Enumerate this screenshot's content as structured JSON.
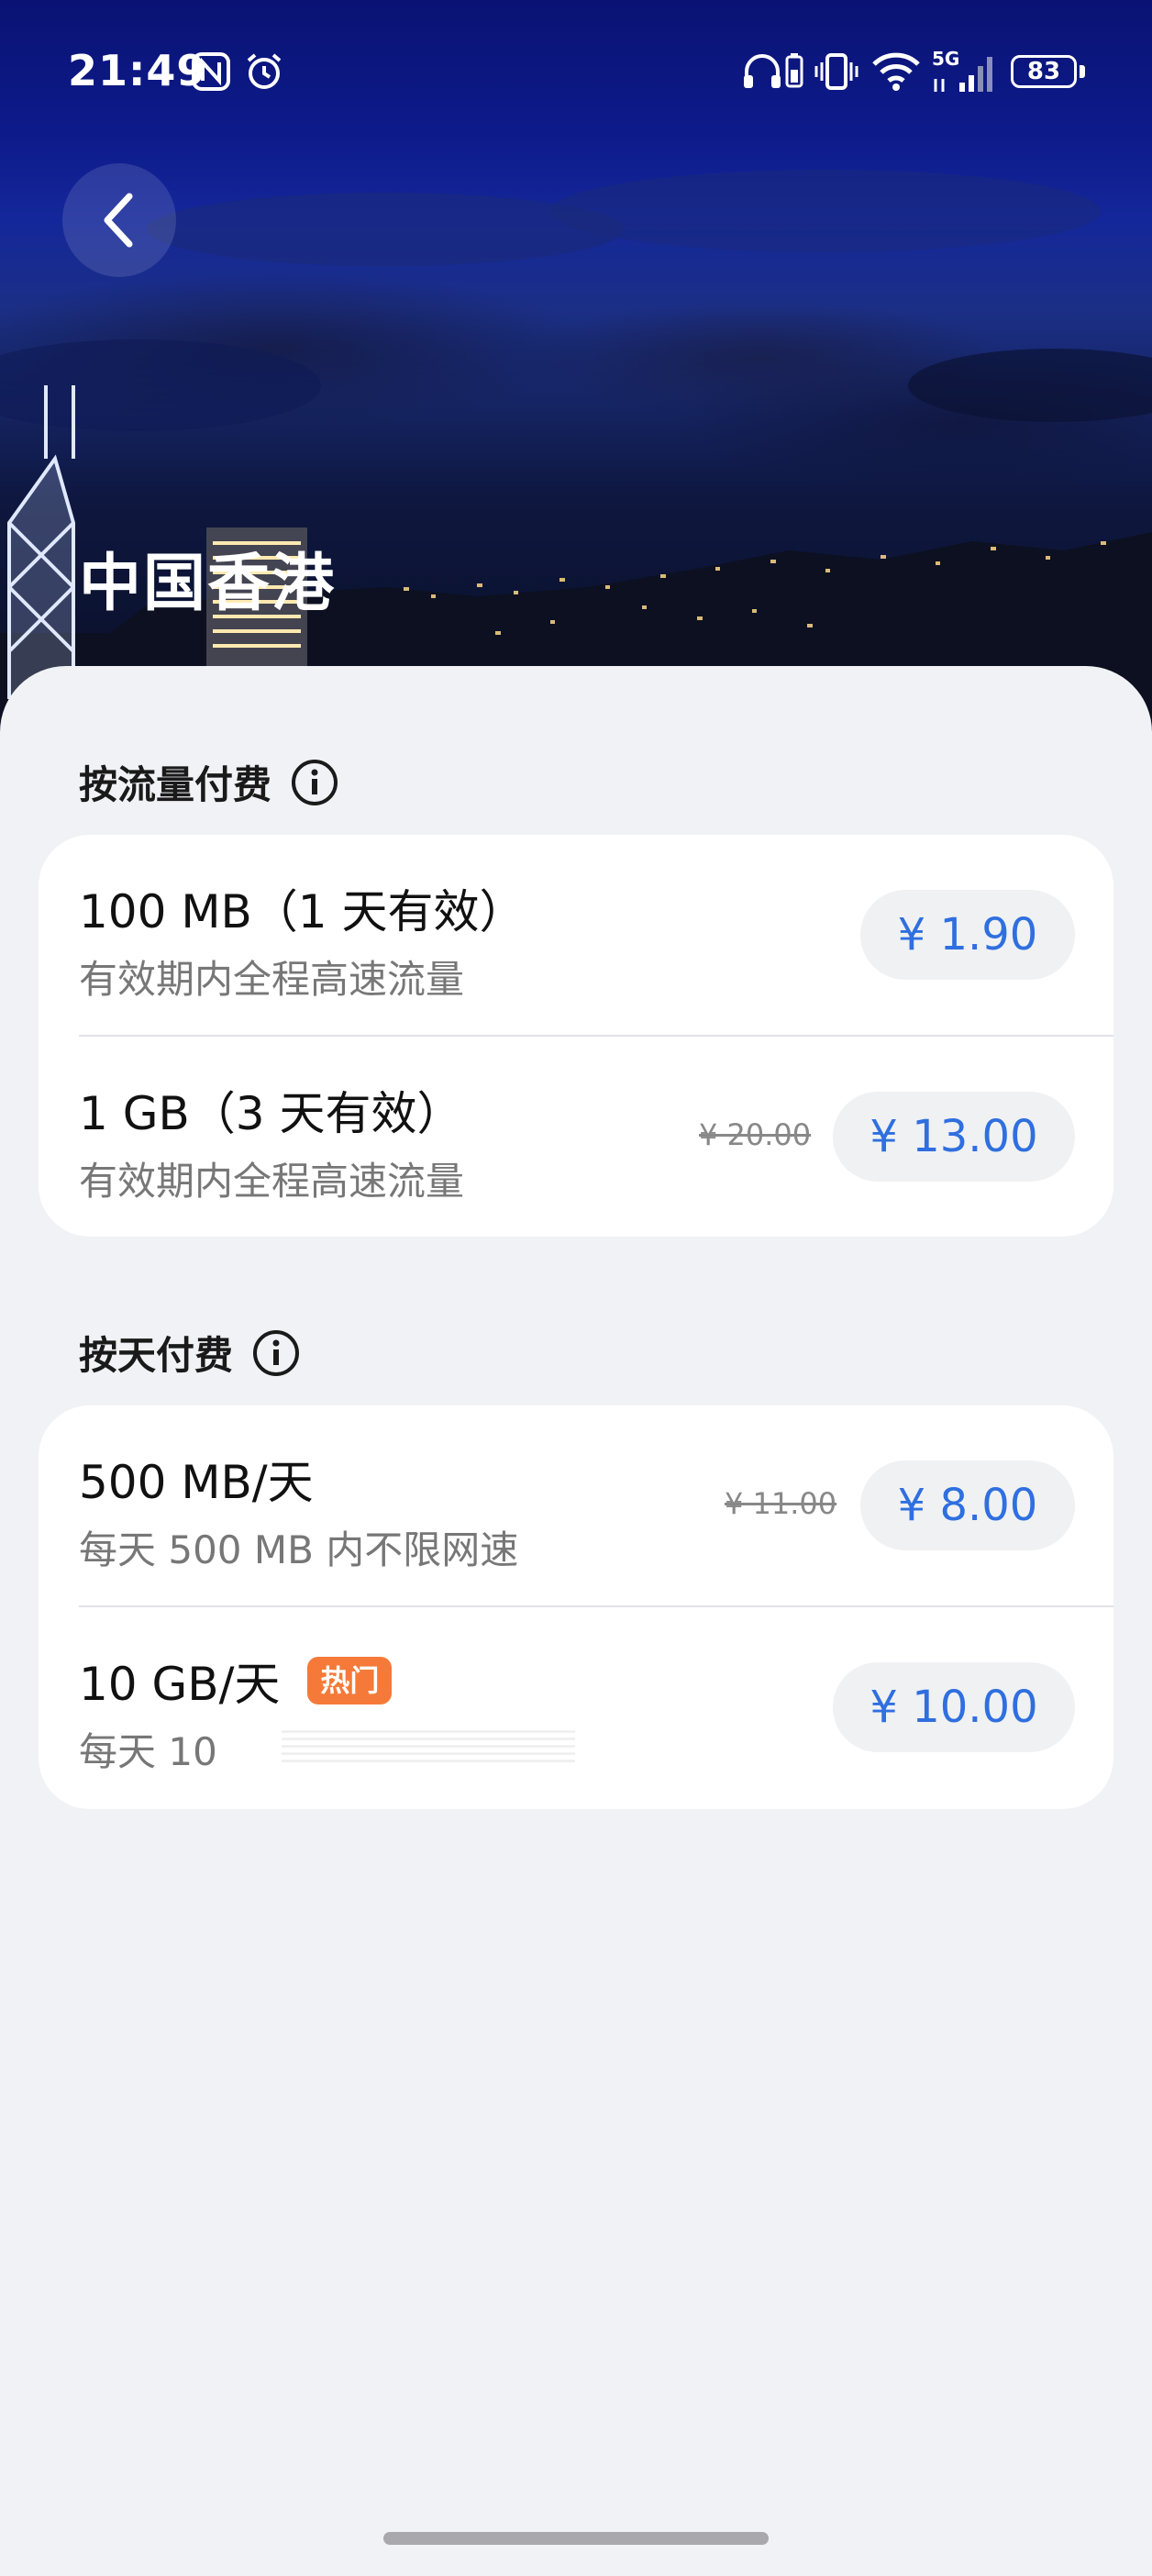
{
  "status_bar": {
    "time": "21:49",
    "battery": "83",
    "network": "5G",
    "icons": [
      "nfc-icon",
      "alarm-icon",
      "headphones-icon",
      "battery-saver-icon",
      "vibrate-icon",
      "wifi-icon",
      "signal-icon"
    ]
  },
  "header": {
    "back_icon": "chevron-left-icon",
    "title": "中国香港"
  },
  "sections": [
    {
      "title": "按流量付费",
      "info_icon": "info-icon",
      "plans": [
        {
          "title": "100 MB（1 天有效）",
          "subtitle": "有效期内全程高速流量",
          "original_price": "",
          "price": "¥ 1.90",
          "badge": ""
        },
        {
          "title": "1 GB（3 天有效）",
          "subtitle": "有效期内全程高速流量",
          "original_price": "¥ 20.00",
          "price": "¥ 13.00",
          "badge": ""
        }
      ]
    },
    {
      "title": "按天付费",
      "info_icon": "info-icon",
      "plans": [
        {
          "title": "500 MB/天",
          "subtitle": "每天 500 MB 内不限网速",
          "original_price": "¥ 11.00",
          "price": "¥ 8.00",
          "badge": ""
        },
        {
          "title": "10 GB/天",
          "subtitle": "每天 10",
          "original_price": "",
          "price": "¥ 10.00",
          "badge": "热门"
        }
      ]
    }
  ],
  "colors": {
    "price_text": "#2f6fdf",
    "hot_badge": "#f57a39",
    "sheet_bg": "#f1f2f5"
  }
}
